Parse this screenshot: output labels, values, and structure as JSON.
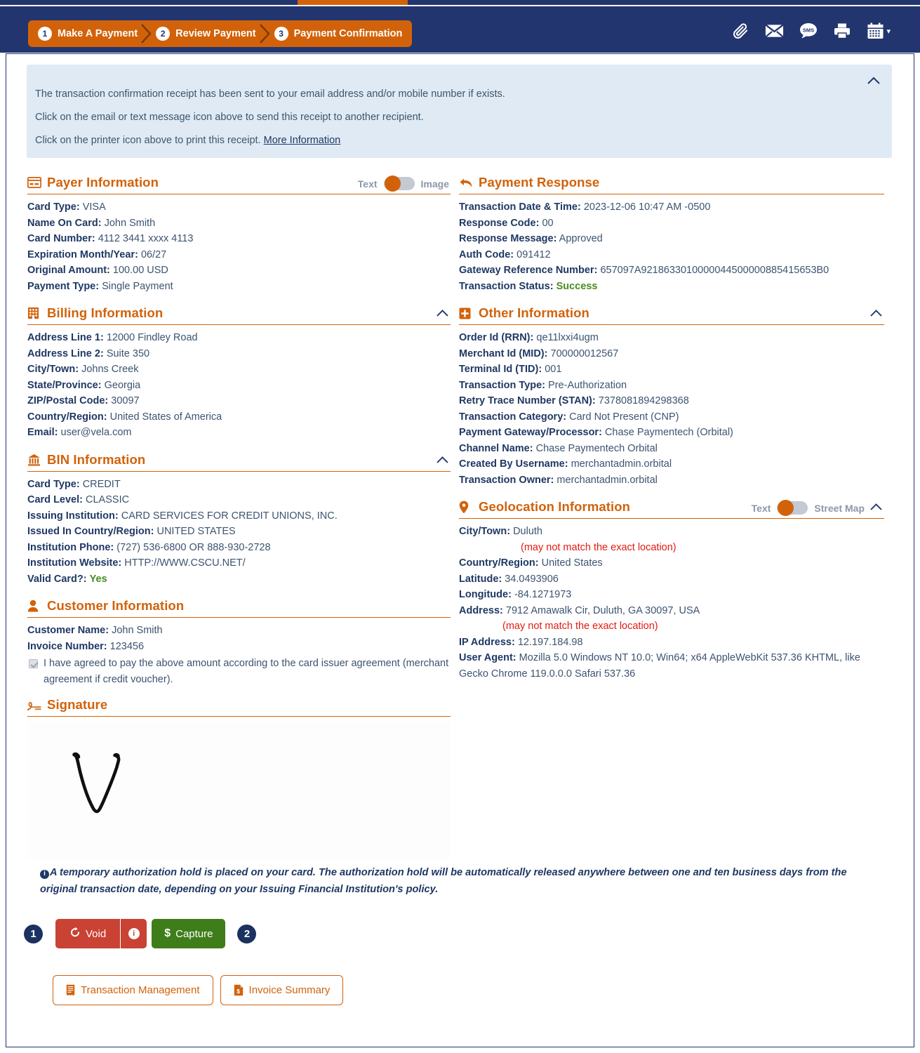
{
  "header": {
    "steps": [
      {
        "num": "1",
        "label": "Make A Payment"
      },
      {
        "num": "2",
        "label": "Review Payment"
      },
      {
        "num": "3",
        "label": "Payment Confirmation"
      }
    ],
    "icons": [
      {
        "name": "attachment-icon",
        "label": "Attachment"
      },
      {
        "name": "email-icon",
        "label": "Email"
      },
      {
        "name": "sms-icon",
        "label": "SMS"
      },
      {
        "name": "print-icon",
        "label": "Print"
      },
      {
        "name": "calendar-icon",
        "label": "Calendar"
      }
    ],
    "calendar_caret": "▾"
  },
  "banner": {
    "line1": "The transaction confirmation receipt has been sent to your email address and/or mobile number if exists.",
    "line2": "Click on the email or text message icon above to send this receipt to another recipient.",
    "line3_prefix": "Click on the printer icon above to print this receipt. ",
    "line3_link": "More Information",
    "collapse_icon": "⌃"
  },
  "payer": {
    "title": "Payer Information",
    "toggle_left": "Text",
    "toggle_right": "Image",
    "rows": [
      {
        "k": "Card Type:",
        "v": "VISA"
      },
      {
        "k": "Name On Card:",
        "v": "John Smith"
      },
      {
        "k": "Card Number:",
        "v": "4112 3441 xxxx 4113"
      },
      {
        "k": "Expiration Month/Year:",
        "v": "06/27"
      },
      {
        "k": "Original Amount:",
        "v": "100.00 USD"
      },
      {
        "k": "Payment Type:",
        "v": "Single Payment"
      }
    ]
  },
  "billing": {
    "title": "Billing Information",
    "collapse_icon": "⌃",
    "rows": [
      {
        "k": "Address Line 1:",
        "v": "12000 Findley Road"
      },
      {
        "k": "Address Line 2:",
        "v": "Suite 350"
      },
      {
        "k": "City/Town:",
        "v": "Johns Creek"
      },
      {
        "k": "State/Province:",
        "v": "Georgia"
      },
      {
        "k": "ZIP/Postal Code:",
        "v": "30097"
      },
      {
        "k": "Country/Region:",
        "v": "United States of America"
      },
      {
        "k": "Email:",
        "v": "user@vela.com"
      }
    ]
  },
  "bin": {
    "title": "BIN Information",
    "collapse_icon": "⌃",
    "rows": [
      {
        "k": "Card Type:",
        "v": "CREDIT"
      },
      {
        "k": "Card Level:",
        "v": "CLASSIC"
      },
      {
        "k": "Issuing Institution:",
        "v": "CARD SERVICES FOR CREDIT UNIONS, INC."
      },
      {
        "k": "Issued In Country/Region:",
        "v": "UNITED STATES"
      },
      {
        "k": "Institution Phone:",
        "v": "(727) 536-6800 OR 888-930-2728"
      },
      {
        "k": "Institution Website:",
        "v": "HTTP://WWW.CSCU.NET/"
      },
      {
        "k": "Valid Card?:",
        "v": "Yes",
        "green": true
      }
    ]
  },
  "customer": {
    "title": "Customer Information",
    "rows": [
      {
        "k": "Customer Name:",
        "v": "John Smith"
      },
      {
        "k": "Invoice Number:",
        "v": "123456"
      }
    ],
    "agreement_checked": true,
    "agreement_text": "I have agreed to pay the above amount according to the card issuer agreement (merchant agreement if credit voucher)."
  },
  "signature": {
    "title": "Signature"
  },
  "payment_response": {
    "title": "Payment Response",
    "rows": [
      {
        "k": "Transaction Date & Time:",
        "v": "2023-12-06 10:47 AM -0500"
      },
      {
        "k": "Response Code:",
        "v": "00"
      },
      {
        "k": "Response Message:",
        "v": "Approved"
      },
      {
        "k": "Auth Code:",
        "v": "091412"
      },
      {
        "k": "Gateway Reference Number:",
        "v": "657097A9218633010000044500000885415653B0"
      },
      {
        "k": "Transaction Status:",
        "v": "Success",
        "green": true
      }
    ]
  },
  "other": {
    "title": "Other Information",
    "collapse_icon": "⌃",
    "rows": [
      {
        "k": "Order Id (RRN):",
        "v": "qe11lxxi4ugm"
      },
      {
        "k": "Merchant Id (MID):",
        "v": "700000012567"
      },
      {
        "k": "Terminal Id (TID):",
        "v": "001"
      },
      {
        "k": "Transaction Type:",
        "v": "Pre-Authorization"
      },
      {
        "k": "Retry Trace Number (STAN):",
        "v": "7378081894298368"
      },
      {
        "k": "Transaction Category:",
        "v": "Card Not Present (CNP)"
      },
      {
        "k": "Payment Gateway/Processor:",
        "v": "Chase Paymentech (Orbital)"
      },
      {
        "k": "Channel Name:",
        "v": "Chase Paymentech Orbital"
      },
      {
        "k": "Created By Username:",
        "v": "merchantadmin.orbital"
      },
      {
        "k": "Transaction Owner:",
        "v": "merchantadmin.orbital"
      }
    ]
  },
  "geolocation": {
    "title": "Geolocation Information",
    "toggle_left": "Text",
    "toggle_right": "Street Map",
    "collapse_icon": "⌃",
    "city_k": "City/Town:",
    "city_v": "Duluth",
    "city_note": "(may not match the exact location)",
    "rows_mid": [
      {
        "k": "Country/Region:",
        "v": "United States"
      },
      {
        "k": "Latitude:",
        "v": "34.0493906"
      },
      {
        "k": "Longitude:",
        "v": "-84.1271973"
      }
    ],
    "address_k": "Address:",
    "address_v": "7912 Amawalk Cir, Duluth, GA 30097, USA",
    "address_note": "(may not match the exact location)",
    "rows_end": [
      {
        "k": "IP Address:",
        "v": "12.197.184.98"
      },
      {
        "k": "User Agent:",
        "v": "Mozilla 5.0 Windows NT 10.0; Win64; x64 AppleWebKit 537.36 KHTML, like Gecko Chrome 119.0.0.0 Safari 537.36"
      }
    ]
  },
  "footer": {
    "hold_note": "A temporary authorization hold is placed on your card. The authorization hold will be automatically released anywhere between one and ten business days from the original transaction date, depending on your Issuing Financial Institution's policy.",
    "info_glyph": "i",
    "badge_1": "1",
    "badge_2": "2",
    "void_label": "Void",
    "void_info_glyph": "i",
    "capture_label": "Capture",
    "capture_currency": "$",
    "transaction_management_label": "Transaction Management",
    "invoice_summary_label": "Invoice Summary"
  },
  "colors": {
    "navy": "#22356f",
    "orange": "#d2620a",
    "banner_bg": "#dfeaf4",
    "green": "#4a8b1e",
    "red": "#e11b13",
    "void_red": "#c94234",
    "capture_green": "#3f7d1b"
  }
}
